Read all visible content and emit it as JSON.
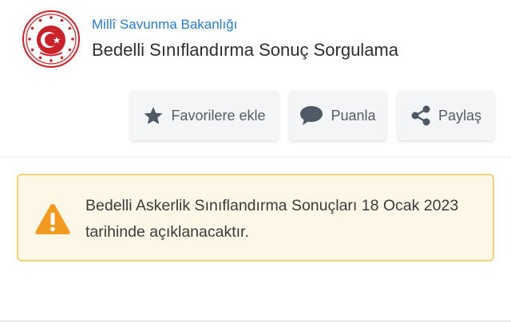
{
  "header": {
    "ministry": "Millî Savunma Bakanlığı",
    "service_title": "Bedelli Sınıflandırma Sonuç Sorgulama",
    "logo_icon": "ministry-emblem-icon"
  },
  "actions": {
    "favorite_label": "Favorilere ekle",
    "favorite_icon": "star-icon",
    "rate_label": "Puanla",
    "rate_icon": "speech-bubble-icon",
    "share_label": "Paylaş",
    "share_icon": "share-icon"
  },
  "alert": {
    "icon": "warning-icon",
    "message": "Bedelli Askerlik Sınıflandırma Sonuçları 18 Ocak 2023 tarihinde açıklanacaktır."
  },
  "colors": {
    "ministry_blue": "#2a7cc7",
    "warning_orange": "#f29a1f",
    "alert_border": "#efd27a",
    "alert_bg": "#fdf7e8",
    "emblem_red": "#c9222b"
  }
}
